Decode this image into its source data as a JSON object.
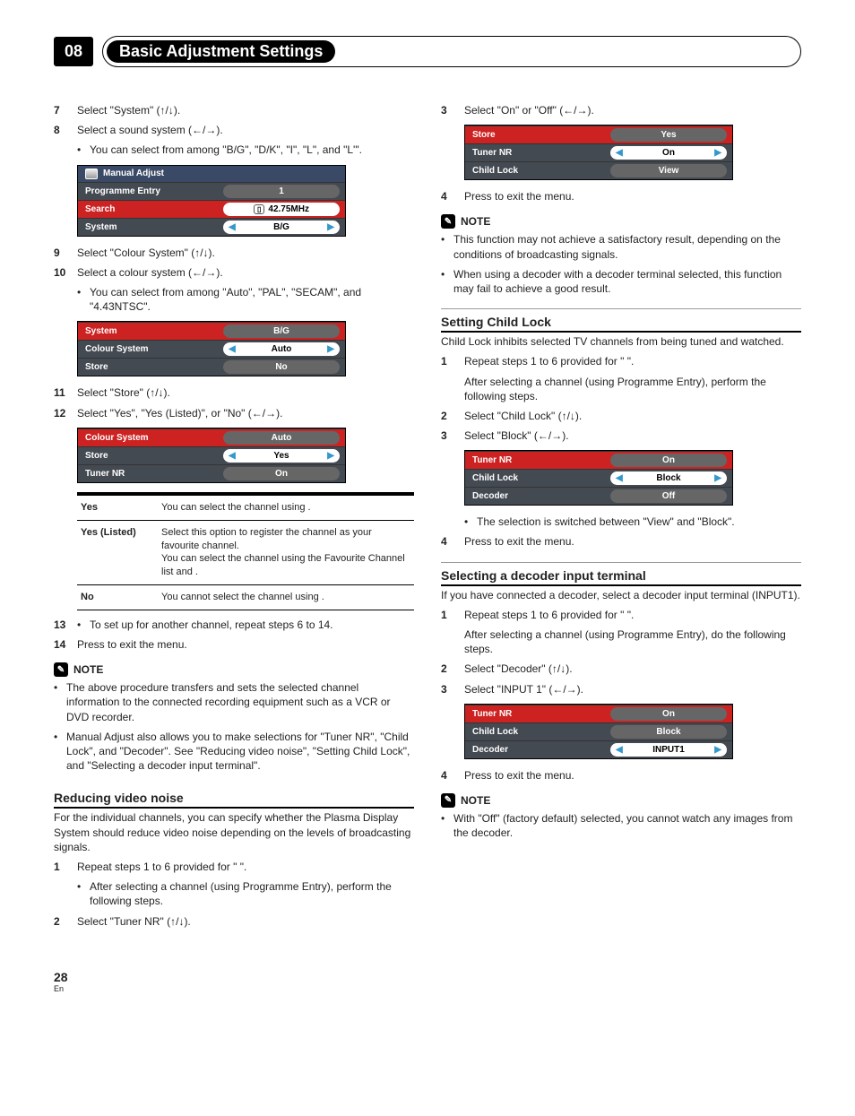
{
  "chapter": {
    "num": "08",
    "title": "Basic Adjustment Settings"
  },
  "left": {
    "step7": "Select \"System\" (↑/↓).",
    "step8": "Select a sound system (←/→).",
    "step8_bullet": "You can select from among \"B/G\", \"D/K\", \"I\", \"L\", and \"L'\".",
    "menu1": {
      "title": "Manual Adjust",
      "rows": [
        {
          "label": "Programme Entry",
          "val": "1",
          "style": "graypill"
        },
        {
          "label": "Search",
          "val": "42.75MHz",
          "style": "searchpill",
          "hl": true
        },
        {
          "label": "System",
          "val": "B/G",
          "style": "whitepill"
        }
      ]
    },
    "step9": "Select \"Colour System\" (↑/↓).",
    "step10": "Select a colour system (←/→).",
    "step10_bullet": "You can select from among \"Auto\", \"PAL\", \"SECAM\", and \"4.43NTSC\".",
    "menu2": {
      "rows": [
        {
          "label": "System",
          "val": "B/G",
          "style": "graypill",
          "hl": true
        },
        {
          "label": "Colour System",
          "val": "Auto",
          "style": "whitepill"
        },
        {
          "label": "Store",
          "val": "No",
          "style": "graypill"
        }
      ]
    },
    "step11": "Select \"Store\" (↑/↓).",
    "step12": "Select \"Yes\", \"Yes (Listed)\", or \"No\" (←/→).",
    "menu3": {
      "rows": [
        {
          "label": "Colour System",
          "val": "Auto",
          "style": "graypill",
          "hl": true
        },
        {
          "label": "Store",
          "val": "Yes",
          "style": "whitepill"
        },
        {
          "label": "Tuner NR",
          "val": "On",
          "style": "graypill"
        }
      ]
    },
    "defs": [
      {
        "t": "Yes",
        "d": "You can select the channel using                    ."
      },
      {
        "t": "Yes (Listed)",
        "d": "Select this option to register the channel as your favourite channel.\nYou can select the channel using the Favourite Channel list and                    ."
      },
      {
        "t": "No",
        "d": "You cannot select the channel using                    ."
      }
    ],
    "step13_b": "To set up for another channel, repeat steps 6 to 14.",
    "step14": "Press                       to exit the menu.",
    "note_label": "NOTE",
    "note1": "The above procedure transfers and sets the selected channel information to the connected recording equipment such as a VCR or DVD recorder.",
    "note2": "Manual Adjust also allows you to make selections for \"Tuner NR\", \"Child Lock\", and \"Decoder\". See \"Reducing video noise\", \"Setting Child Lock\", and \"Selecting a decoder input terminal\".",
    "h_reduce": "Reducing video noise",
    "reduce_p": "For the individual channels, you can specify whether the Plasma Display System should reduce video noise depending on the levels of broadcasting signals.",
    "r_step1": "Repeat steps 1 to 6 provided for \"                                              \".",
    "r_step1b": "After selecting a channel (using Programme Entry), perform the following steps.",
    "r_step2": "Select \"Tuner NR\" (↑/↓)."
  },
  "right": {
    "step3": "Select \"On\" or \"Off\" (←/→).",
    "menu4": {
      "rows": [
        {
          "label": "Store",
          "val": "Yes",
          "style": "graypill",
          "hl": true
        },
        {
          "label": "Tuner NR",
          "val": "On",
          "style": "whitepill"
        },
        {
          "label": "Child Lock",
          "val": "View",
          "style": "graypill"
        }
      ]
    },
    "step4": "Press                       to exit the menu.",
    "note_label": "NOTE",
    "noteA": "This function may not achieve a satisfactory result, depending on the conditions of broadcasting signals.",
    "noteB": "When using a decoder with a decoder terminal selected, this function may fail to achieve a good result.",
    "h_child": "Setting Child Lock",
    "child_p": "Child Lock inhibits selected TV channels from being tuned and watched.",
    "c1": "Repeat steps 1 to 6 provided for \"                                              \".",
    "c2": "After selecting a channel (using Programme Entry), perform the following steps.",
    "c3": "Select \"Child Lock\" (↑/↓).",
    "c4": "Select \"Block\" (←/→).",
    "menu5": {
      "rows": [
        {
          "label": "Tuner NR",
          "val": "On",
          "style": "graypill",
          "hl": true
        },
        {
          "label": "Child Lock",
          "val": "Block",
          "style": "whitepill"
        },
        {
          "label": "Decoder",
          "val": "Off",
          "style": "graypill"
        }
      ]
    },
    "c_b": "The selection is switched between \"View\" and \"Block\".",
    "c5": "Press                       to exit the menu.",
    "h_dec": "Selecting a decoder input terminal",
    "dec_p": "If you have connected a decoder, select a decoder input terminal (INPUT1).",
    "d1": "Repeat steps 1 to 6 provided for \"                                              \".",
    "d2": "After selecting a channel (using Programme Entry), do the following steps.",
    "d3": "Select \"Decoder\" (↑/↓).",
    "d4": "Select \"INPUT 1\" (←/→).",
    "menu6": {
      "rows": [
        {
          "label": "Tuner NR",
          "val": "On",
          "style": "graypill",
          "hl": true
        },
        {
          "label": "Child Lock",
          "val": "Block",
          "style": "graypill"
        },
        {
          "label": "Decoder",
          "val": "INPUT1",
          "style": "whitepill"
        }
      ]
    },
    "d5": "Press                       to exit the menu.",
    "noteC": "With \"Off\" (factory default) selected, you cannot watch any images from the decoder."
  },
  "foot": {
    "page": "28",
    "lang": "En"
  }
}
